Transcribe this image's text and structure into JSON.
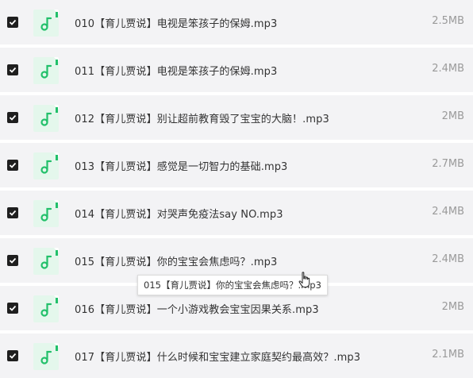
{
  "files": [
    {
      "name": "010【育儿贾说】电视是笨孩子的保姆.mp3",
      "size": "2.5MB",
      "checked": true,
      "icon": "music-note-icon"
    },
    {
      "name": "011【育儿贾说】电视是笨孩子的保姆.mp3",
      "size": "2.4MB",
      "checked": true,
      "icon": "music-note-icon"
    },
    {
      "name": "012【育儿贾说】别让超前教育毁了宝宝的大脑！.mp3",
      "size": "2MB",
      "checked": true,
      "icon": "music-note-icon"
    },
    {
      "name": "013【育儿贾说】感觉是一切智力的基础.mp3",
      "size": "2.7MB",
      "checked": true,
      "icon": "music-note-icon"
    },
    {
      "name": "014【育儿贾说】对哭声免疫法say NO.mp3",
      "size": "2.4MB",
      "checked": true,
      "icon": "music-note-icon"
    },
    {
      "name": "015【育儿贾说】你的宝宝会焦虑吗？.mp3",
      "size": "2.4MB",
      "checked": true,
      "icon": "music-note-icon"
    },
    {
      "name": "016【育儿贾说】一个小游戏教会宝宝因果关系.mp3",
      "size": "2MB",
      "checked": true,
      "icon": "music-note-icon"
    },
    {
      "name": "017【育儿贾说】什么时候和宝宝建立家庭契约最高效？.mp3",
      "size": "2.1MB",
      "checked": true,
      "icon": "music-note-icon"
    }
  ],
  "tooltip": {
    "text": "015【育儿贾说】你的宝宝会焦虑吗？.mp3"
  },
  "colors": {
    "row_bg": "#f3f3f5",
    "checkbox": "#1f1f1f",
    "icon_bg": "#e4f7ec",
    "icon_accent": "#22c06a",
    "size_text": "#9a9a9a"
  }
}
